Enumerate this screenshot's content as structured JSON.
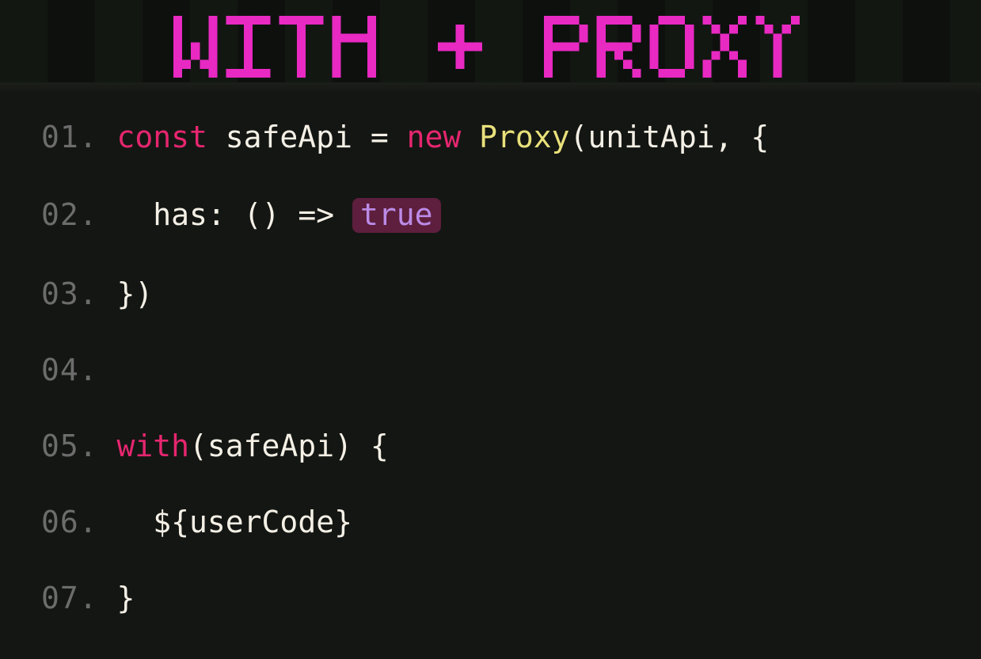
{
  "title": "with + Proxy",
  "code": {
    "lines": [
      {
        "n": "01.",
        "tokens": [
          {
            "t": "const",
            "c": "kw"
          },
          {
            "t": " ",
            "c": "op"
          },
          {
            "t": "safeApi",
            "c": "id"
          },
          {
            "t": " ",
            "c": "op"
          },
          {
            "t": "=",
            "c": "op"
          },
          {
            "t": " ",
            "c": "op"
          },
          {
            "t": "new",
            "c": "kw"
          },
          {
            "t": " ",
            "c": "op"
          },
          {
            "t": "Proxy",
            "c": "cls"
          },
          {
            "t": "(",
            "c": "pn"
          },
          {
            "t": "unitApi",
            "c": "id"
          },
          {
            "t": ",",
            "c": "op"
          },
          {
            "t": " ",
            "c": "op"
          },
          {
            "t": "{",
            "c": "pn"
          }
        ]
      },
      {
        "n": "02.",
        "tokens": [
          {
            "t": "  ",
            "c": "op"
          },
          {
            "t": "has",
            "c": "id"
          },
          {
            "t": ":",
            "c": "op"
          },
          {
            "t": " ",
            "c": "op"
          },
          {
            "t": "()",
            "c": "pn"
          },
          {
            "t": " ",
            "c": "op"
          },
          {
            "t": "=>",
            "c": "op"
          },
          {
            "t": " ",
            "c": "op"
          },
          {
            "t": "true",
            "c": "bool"
          }
        ]
      },
      {
        "n": "03.",
        "tokens": [
          {
            "t": "})",
            "c": "pn"
          }
        ]
      },
      {
        "n": "04.",
        "tokens": []
      },
      {
        "n": "05.",
        "tokens": [
          {
            "t": "with",
            "c": "kw"
          },
          {
            "t": "(",
            "c": "pn"
          },
          {
            "t": "safeApi",
            "c": "id"
          },
          {
            "t": ")",
            "c": "pn"
          },
          {
            "t": " ",
            "c": "op"
          },
          {
            "t": "{",
            "c": "pn"
          }
        ]
      },
      {
        "n": "06.",
        "tokens": [
          {
            "t": "  ",
            "c": "op"
          },
          {
            "t": "${",
            "c": "tmpl"
          },
          {
            "t": "userCode",
            "c": "id"
          },
          {
            "t": "}",
            "c": "tmpl"
          }
        ]
      },
      {
        "n": "07.",
        "tokens": [
          {
            "t": "}",
            "c": "pn"
          }
        ]
      }
    ]
  }
}
